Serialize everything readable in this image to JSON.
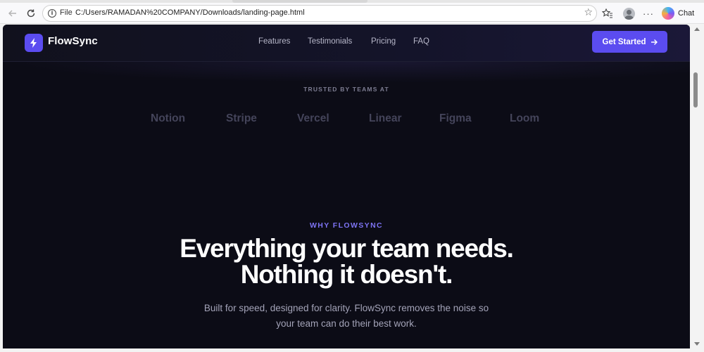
{
  "browser": {
    "scheme_label": "File",
    "url": "C:/Users/RAMADAN%20COMPANY/Downloads/landing-page.html",
    "chat_label": "Chat",
    "icons": [
      "back-icon",
      "reload-icon",
      "info-icon",
      "star-icon",
      "favorites-icon",
      "profile-icon",
      "more-icon",
      "copilot-icon"
    ]
  },
  "site": {
    "brand": "FlowSync",
    "nav": [
      "Features",
      "Testimonials",
      "Pricing",
      "FAQ"
    ],
    "cta_label": "Get Started",
    "accent": "#5b4cf0"
  },
  "trusted": {
    "label": "TRUSTED BY TEAMS AT",
    "brands": [
      "Notion",
      "Stripe",
      "Vercel",
      "Linear",
      "Figma",
      "Loom"
    ]
  },
  "hero": {
    "eyebrow": "WHY FLOWSYNC",
    "headline_line1": "Everything your team needs.",
    "headline_line2": "Nothing it doesn't.",
    "sub_line1": "Built for speed, designed for clarity. FlowSync removes the noise so",
    "sub_line2": "your team can do their best work."
  }
}
